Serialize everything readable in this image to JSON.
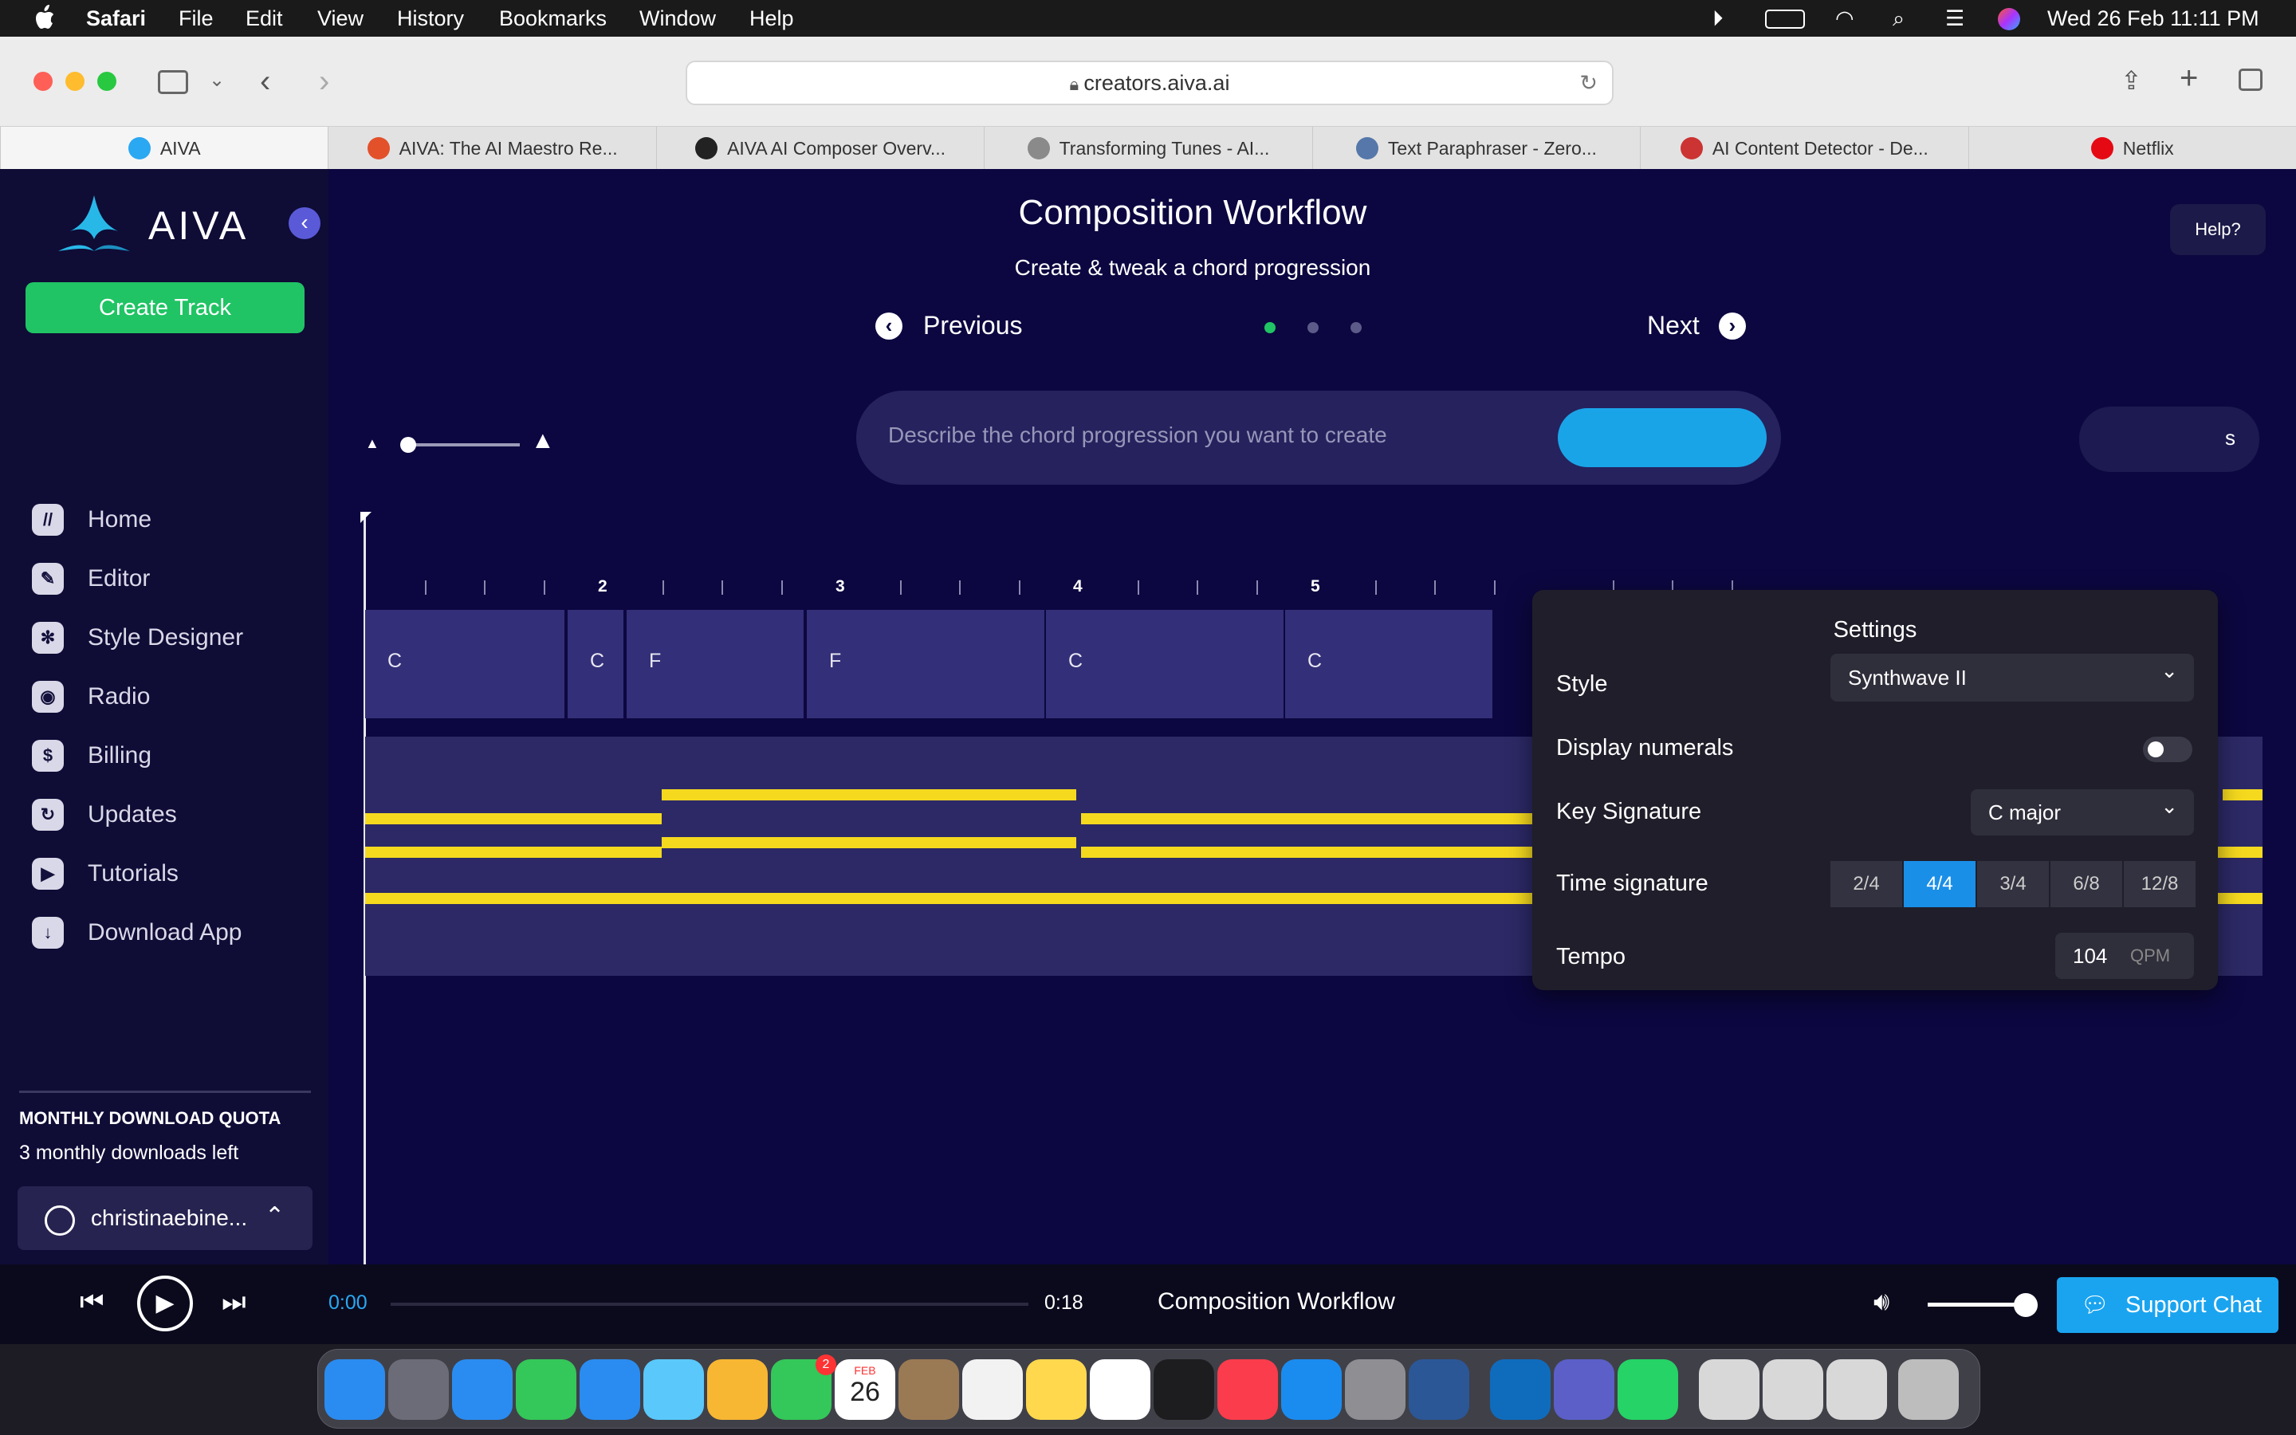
{
  "menubar": {
    "app": "Safari",
    "items": [
      "File",
      "Edit",
      "View",
      "History",
      "Bookmarks",
      "Window",
      "Help"
    ],
    "datetime": "Wed 26 Feb  11:11 PM"
  },
  "browser": {
    "url": "creators.aiva.ai",
    "tabs": [
      {
        "label": "AIVA",
        "color": "#2aa8f2"
      },
      {
        "label": "AIVA: The AI Maestro Re...",
        "color": "#e2512a"
      },
      {
        "label": "AIVA AI Composer Overv...",
        "color": "#222222"
      },
      {
        "label": "Transforming Tunes - AI...",
        "color": "#8a8a8a"
      },
      {
        "label": "Text Paraphraser - Zero...",
        "color": "#5577aa"
      },
      {
        "label": "AI Content Detector - De...",
        "color": "#cc3333"
      },
      {
        "label": "Netflix",
        "color": "#e50914"
      }
    ]
  },
  "sidebar": {
    "brand": "AIVA",
    "create_track": "Create Track",
    "nav": [
      {
        "label": "Home",
        "icon": "home-icon",
        "glyph": "//"
      },
      {
        "label": "Editor",
        "icon": "pencil-icon",
        "glyph": "✎"
      },
      {
        "label": "Style Designer",
        "icon": "style-icon",
        "glyph": "✻"
      },
      {
        "label": "Radio",
        "icon": "radio-icon",
        "glyph": "◉"
      },
      {
        "label": "Billing",
        "icon": "dollar-icon",
        "glyph": "$"
      },
      {
        "label": "Updates",
        "icon": "updates-icon",
        "glyph": "↻"
      },
      {
        "label": "Tutorials",
        "icon": "play-icon",
        "glyph": "▶"
      },
      {
        "label": "Download App",
        "icon": "download-icon",
        "glyph": "↓"
      }
    ],
    "quota_title": "MONTHLY DOWNLOAD QUOTA",
    "quota_text": "3 monthly downloads left",
    "user": "christinaebine..."
  },
  "workflow": {
    "title": "Composition Workflow",
    "subtitle": "Create & tweak a chord progression",
    "previous": "Previous",
    "next": "Next",
    "help": "Help?",
    "prompt_placeholder": "Describe the chord progression you want to create",
    "partial_button_text": "s"
  },
  "timeline": {
    "bar_numbers": [
      "2",
      "3",
      "4",
      "5"
    ],
    "chords": [
      "C",
      "C",
      "F",
      "F",
      "C",
      "C"
    ]
  },
  "settings": {
    "title": "Settings",
    "style_label": "Style",
    "style_value": "Synthwave II",
    "numerals_label": "Display numerals",
    "numerals_on": false,
    "key_label": "Key Signature",
    "key_value": "C major",
    "time_label": "Time signature",
    "time_options": [
      "2/4",
      "4/4",
      "3/4",
      "6/8",
      "12/8"
    ],
    "time_selected": "4/4",
    "tempo_label": "Tempo",
    "tempo_value": "104",
    "tempo_unit": "QPM"
  },
  "player": {
    "current": "0:00",
    "duration": "0:18",
    "track": "Composition Workflow",
    "support": "Support Chat"
  },
  "dock": {
    "calendar_month": "FEB",
    "calendar_day": "26",
    "facetime_badge": "2"
  }
}
